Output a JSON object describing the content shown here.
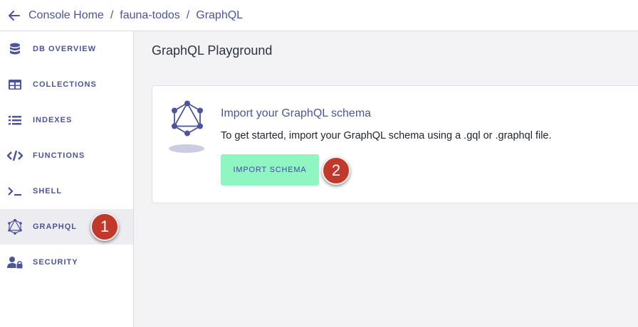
{
  "breadcrumb": {
    "items": [
      "Console Home",
      "fauna-todos",
      "GraphQL"
    ],
    "separator": "/"
  },
  "sidebar": {
    "items": [
      {
        "label": "DB OVERVIEW",
        "icon": "database-icon"
      },
      {
        "label": "COLLECTIONS",
        "icon": "table-icon"
      },
      {
        "label": "INDEXES",
        "icon": "list-icon"
      },
      {
        "label": "FUNCTIONS",
        "icon": "code-icon"
      },
      {
        "label": "SHELL",
        "icon": "terminal-icon"
      },
      {
        "label": "GRAPHQL",
        "icon": "graphql-icon",
        "active": true
      },
      {
        "label": "SECURITY",
        "icon": "users-lock-icon"
      }
    ]
  },
  "main": {
    "title": "GraphQL Playground",
    "card": {
      "title": "Import your GraphQL schema",
      "description": "To get started, import your GraphQL schema using a .gql or .graphql file.",
      "button_label": "IMPORT SCHEMA"
    }
  },
  "annotations": {
    "step1": "1",
    "step2": "2"
  },
  "colors": {
    "accent": "#4d5499",
    "button_bg": "#8ff5c1",
    "badge": "#c0392b"
  }
}
